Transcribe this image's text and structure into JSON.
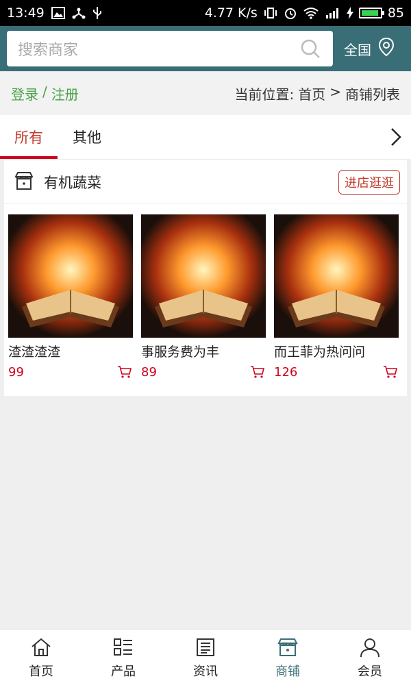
{
  "status_bar": {
    "time": "13:49",
    "net_speed": "4.77 K/s",
    "battery": "85",
    "battery_level": 0.85
  },
  "header": {
    "search_placeholder": "搜索商家",
    "region": "全国"
  },
  "location_row": {
    "login": "登录",
    "separator": "/",
    "register": "注册",
    "current_label": "当前位置:",
    "crumb_home": "首页",
    "crumb_sep": ">",
    "crumb_current": "商铺列表"
  },
  "tabs": [
    {
      "label": "所有"
    },
    {
      "label": "其他"
    }
  ],
  "shop": {
    "name": "有机蔬菜",
    "enter_label": "进店逛逛",
    "products": [
      {
        "name": "渣渣渣渣",
        "price": "99"
      },
      {
        "name": "事服务费为丰",
        "price": "89"
      },
      {
        "name": "而王菲为热问问",
        "price": "126"
      }
    ]
  },
  "bottom_nav": [
    {
      "label": "首页"
    },
    {
      "label": "产品"
    },
    {
      "label": "资讯"
    },
    {
      "label": "商铺"
    },
    {
      "label": "会员"
    }
  ],
  "colors": {
    "header": "#3a6e77",
    "accent_red": "#d0021b",
    "login_green": "#4aa24a"
  }
}
